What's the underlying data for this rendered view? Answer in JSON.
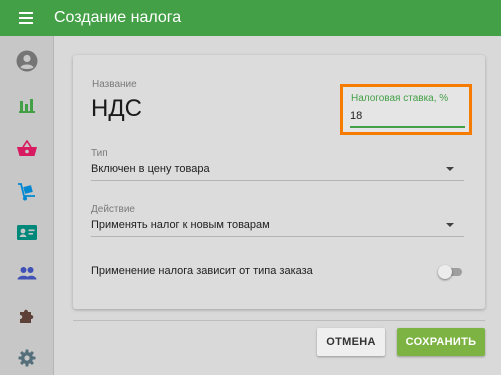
{
  "app": {
    "title": "Создание налога",
    "accent_color": "#43a047"
  },
  "sidebar": {
    "items": [
      {
        "icon": "account-circle-icon",
        "color": "#757575"
      },
      {
        "icon": "bar-chart-icon",
        "color": "#43a047"
      },
      {
        "icon": "shopping-basket-icon",
        "color": "#d81b60"
      },
      {
        "icon": "dolly-cart-icon",
        "color": "#0288d1"
      },
      {
        "icon": "contact-card-icon",
        "color": "#00897b"
      },
      {
        "icon": "people-icon",
        "color": "#3f51b5"
      },
      {
        "icon": "puzzle-icon",
        "color": "#5d4037"
      },
      {
        "icon": "gear-icon",
        "color": "#546e7a"
      }
    ]
  },
  "form": {
    "name": {
      "label": "Название",
      "value": "НДС"
    },
    "rate": {
      "label": "Налоговая ставка, %",
      "value": "18",
      "highlight_color": "#f57c00"
    },
    "type": {
      "label": "Тип",
      "value": "Включен в цену товара"
    },
    "action": {
      "label": "Действие",
      "value": "Применять налог к новым товарам"
    },
    "depends": {
      "label": "Применение налога зависит от типа заказа",
      "enabled": false
    }
  },
  "buttons": {
    "cancel": "ОТМЕНА",
    "save": "СОХРАНИТЬ"
  }
}
